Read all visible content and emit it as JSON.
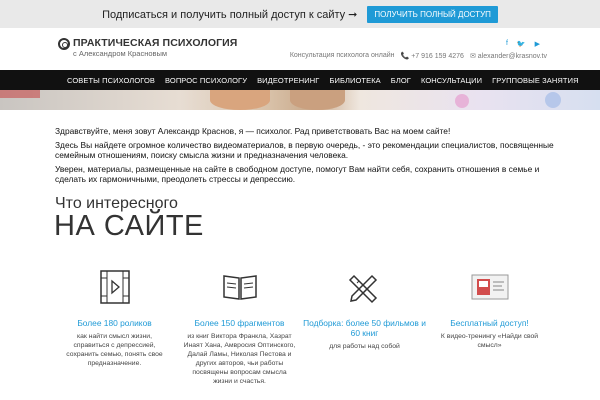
{
  "promo": {
    "text": "Подписаться и получить полный доступ к сайту ➞",
    "button": "ПОЛУЧИТЬ ПОЛНЫЙ ДОСТУП"
  },
  "logo": {
    "title": "ПРАКТИЧЕСКАЯ ПСИХОЛОГИЯ",
    "subtitle": "с Александром Красновым"
  },
  "contacts": {
    "consult": "Консультация психолога онлайн",
    "phone": "📞 +7 916 159 4276",
    "email": "✉ alexander@krasnov.tv"
  },
  "socials": [
    "f",
    "🐦",
    "▶"
  ],
  "nav": [
    "СОВЕТЫ ПСИХОЛОГОВ",
    "ВОПРОС ПСИХОЛОГУ",
    "ВИДЕОТРЕНИНГ",
    "БИБЛИОТЕКА",
    "БЛОГ",
    "КОНСУЛЬТАЦИИ",
    "ГРУППОВЫЕ ЗАНЯТИЯ"
  ],
  "intro": {
    "p1": "Здравствуйте, меня зовут Александр Краснов,  я — психолог. Рад приветствовать Вас на моем сайте!",
    "p2": "Здесь Вы найдете огромное количество видеоматериалов, в первую очередь, - это рекомендации специалистов, посвященные семейным отношениям, поиску смысла жизни и предназначения человека.",
    "p3": "Уверен, материалы, размещенные на сайте в свободном доступе, помогут Вам найти себя, сохранить отношения в семье и сделать их гармоничными, преодолеть стрессы и депрессию."
  },
  "section": {
    "subtitle": "Что интересного",
    "title": "НА САЙТЕ"
  },
  "features": [
    {
      "icon": "film-icon",
      "title": "Более 180 роликов",
      "desc": "как найти смысл жизни, справиться с депрессией, сохранить семью, понять свое предназначение."
    },
    {
      "icon": "book-icon",
      "title": "Более 150 фрагментов",
      "desc": "из книг Виктора Франкла, Хазрат Инаят Хана, Амвросия Оптинского, Далай Ламы, Николая Пестова и других авторов, чьи работы посвящены вопросам смысла жизни и счастья."
    },
    {
      "icon": "pencil-ruler-icon",
      "title": "Подборка: более 50 фильмов и 60 книг",
      "desc": "для работы над собой"
    },
    {
      "icon": "video-training-icon",
      "title": "Бесплатный доступ!",
      "desc": "К видео-тренингу «Найди свой смысл»"
    }
  ],
  "colors": {
    "accent": "#1f9ad6",
    "nav_bg": "#111111",
    "promo_bg": "#e9e9e9"
  }
}
